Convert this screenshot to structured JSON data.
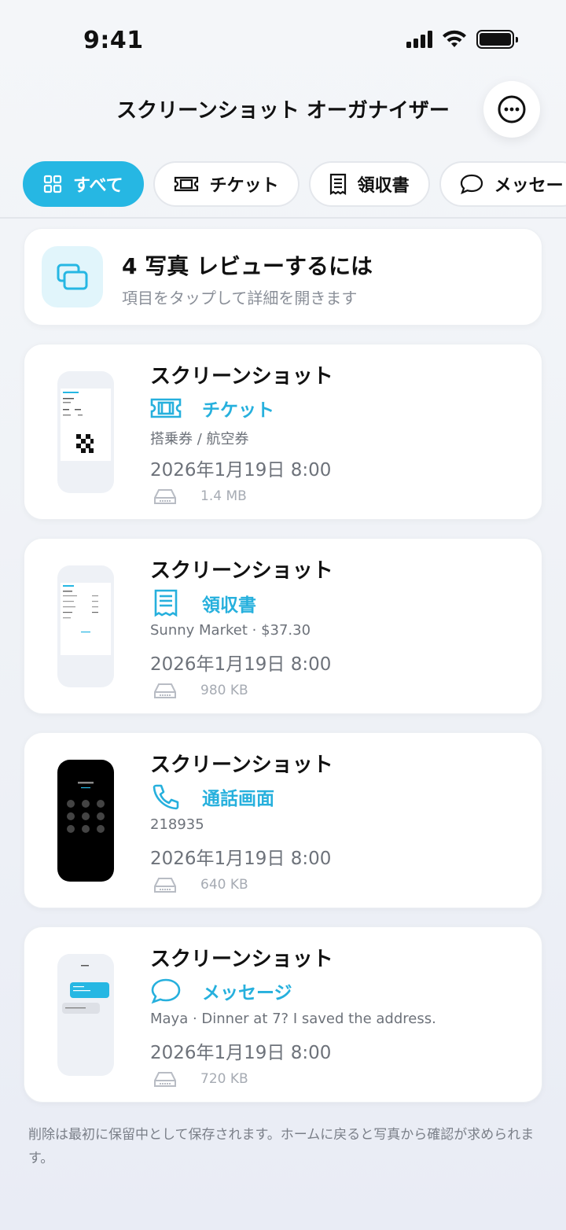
{
  "status": {
    "time": "9:41"
  },
  "header": {
    "title": "スクリーンショット オーガナイザー"
  },
  "filters": [
    {
      "label": "すべて",
      "icon": "grid-icon",
      "active": true
    },
    {
      "label": "チケット",
      "icon": "ticket-icon",
      "active": false
    },
    {
      "label": "領収書",
      "icon": "receipt-icon",
      "active": false
    },
    {
      "label": "メッセー",
      "icon": "chat-bubble-icon",
      "active": false
    }
  ],
  "review": {
    "title": "4 写真 レビューするには",
    "subtitle": "項目をタップして詳細を開きます"
  },
  "items": [
    {
      "title": "スクリーンショット",
      "category": "チケット",
      "category_icon": "ticket-icon",
      "description": "搭乗券 / 航空券",
      "date": "2026年1月19日 8:00",
      "size": "1.4 MB"
    },
    {
      "title": "スクリーンショット",
      "category": "領収書",
      "category_icon": "receipt-icon",
      "description": "Sunny Market · $37.30",
      "date": "2026年1月19日 8:00",
      "size": "980 KB"
    },
    {
      "title": "スクリーンショット",
      "category": "通話画面",
      "category_icon": "phone-icon",
      "description": "218935",
      "date": "2026年1月19日 8:00",
      "size": "640 KB"
    },
    {
      "title": "スクリーンショット",
      "category": "メッセージ",
      "category_icon": "chat-bubble-icon",
      "description": "Maya · Dinner at 7? I saved the address.",
      "date": "2026年1月19日 8:00",
      "size": "720 KB"
    }
  ],
  "footer": {
    "note": "削除は最初に保留中として保存されます。ホームに戻ると写真から確認が求められます。"
  },
  "colors": {
    "accent": "#26b7e3",
    "background": "#eef1f6"
  }
}
